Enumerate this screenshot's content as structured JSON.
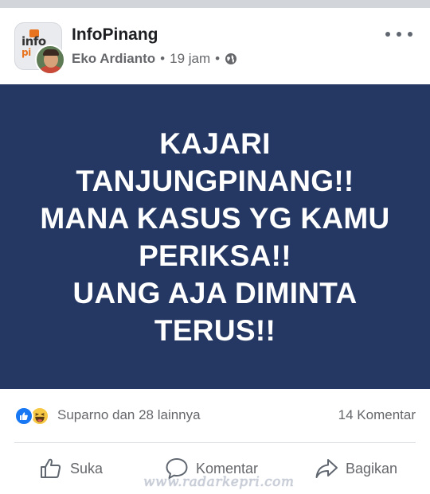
{
  "post": {
    "group_name": "InfoPinang",
    "author": "Eko Ardianto",
    "separator": "•",
    "time": "19 jam",
    "privacy_icon": "globe-icon",
    "avatar_logo_text": "info",
    "avatar_logo_sub": "pi"
  },
  "banner": {
    "background": "#253863",
    "lines": [
      "KAJARI",
      "TANJUNGPINANG!!",
      "MANA KASUS YG KAMU",
      "PERIKSA!!",
      "UANG AJA DIMINTA",
      "TERUS!!"
    ]
  },
  "reactions": {
    "icons": [
      "like-icon",
      "haha-icon"
    ],
    "summary": "Suparno dan 28 lainnya",
    "comments": "14 Komentar"
  },
  "actions": {
    "like_label": "Suka",
    "comment_label": "Komentar",
    "share_label": "Bagikan"
  },
  "watermark": "www.radarkepri.com",
  "colors": {
    "accent": "#1877f2",
    "banner": "#253863",
    "muted_text": "#65676b"
  }
}
